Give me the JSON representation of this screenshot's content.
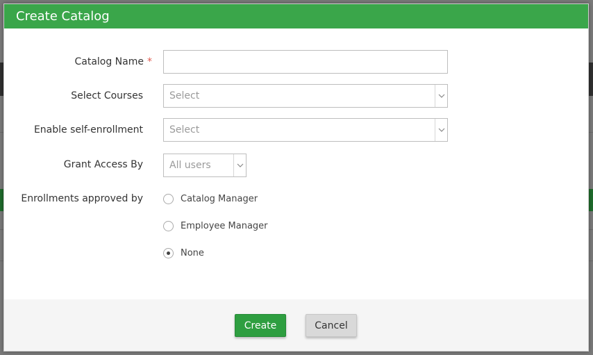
{
  "modal": {
    "title": "Create Catalog"
  },
  "form": {
    "catalog_name": {
      "label": "Catalog Name",
      "required_mark": "*",
      "value": ""
    },
    "select_courses": {
      "label": "Select Courses",
      "value": "Select"
    },
    "self_enrollment": {
      "label": "Enable self-enrollment",
      "value": "Select"
    },
    "grant_access": {
      "label": "Grant Access By",
      "value": "All users"
    },
    "approved_by": {
      "label": "Enrollments approved by",
      "options": [
        {
          "label": "Catalog Manager",
          "checked": false
        },
        {
          "label": "Employee Manager",
          "checked": false
        },
        {
          "label": "None",
          "checked": true
        }
      ]
    }
  },
  "footer": {
    "create_label": "Create",
    "cancel_label": "Cancel"
  },
  "colors": {
    "header": "#3aa64a",
    "primary_button": "#2e9e40",
    "required": "#e05a4f"
  }
}
